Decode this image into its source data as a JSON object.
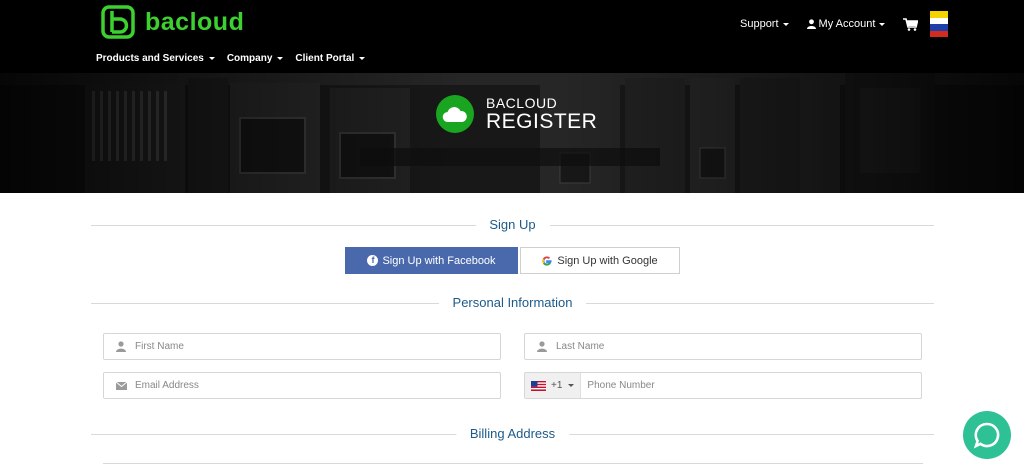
{
  "brand": {
    "name": "bacloud",
    "color": "#3cd12f"
  },
  "topnav": {
    "support": "Support",
    "account": "My Account",
    "cart_icon": "cart-icon",
    "language_flag": "flag-ru-icon"
  },
  "mainnav": {
    "items": [
      {
        "label": "Products and Services"
      },
      {
        "label": "Company"
      },
      {
        "label": "Client Portal"
      }
    ]
  },
  "hero": {
    "small": "BACLOUD",
    "big": "REGISTER",
    "icon": "cloud-icon"
  },
  "signup": {
    "heading": "Sign Up",
    "facebook": "Sign Up with Facebook",
    "google": "Sign Up with Google"
  },
  "personal": {
    "heading": "Personal Information",
    "first_name_placeholder": "First Name",
    "last_name_placeholder": "Last Name",
    "email_placeholder": "Email Address",
    "phone_placeholder": "Phone Number",
    "phone_prefix": "+1"
  },
  "billing": {
    "heading": "Billing Address"
  },
  "colors": {
    "accent": "#1d5a89",
    "facebook": "#4a69ad",
    "chat": "#2fc196"
  }
}
